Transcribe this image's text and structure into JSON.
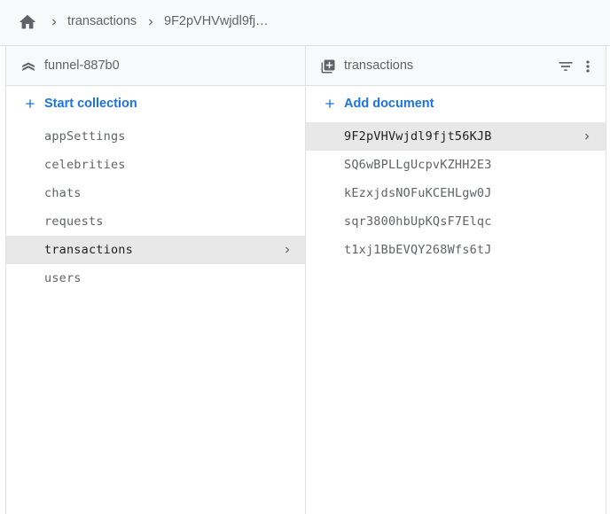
{
  "breadcrumb": {
    "home_icon": "home-icon",
    "items": [
      "transactions",
      "9F2pVHVwjdl9fj…"
    ]
  },
  "left_panel": {
    "project_name": "funnel-887b0",
    "project_icon": "firestore-icon",
    "start_collection_label": "Start collection",
    "collections": [
      "appSettings",
      "celebrities",
      "chats",
      "requests",
      "transactions",
      "users"
    ],
    "selected_collection": "transactions"
  },
  "right_panel": {
    "title": "transactions",
    "title_icon": "collection-icon",
    "add_document_label": "Add document",
    "documents": [
      "9F2pVHVwjdl9fjt56KJB",
      "SQ6wBPLLgUcpvKZHH2E3",
      "kEzxjdsNOFuKCEHLgw0J",
      "sqr3800hbUpKQsF7Elqc",
      "t1xj1BbEVQY268Wfs6tJ"
    ],
    "selected_document": "9F2pVHVwjdl9fjt56KJB"
  },
  "colors": {
    "accent": "#1a73e8",
    "header_bg": "#f8f9fa",
    "selected_bg": "#e8e8e8",
    "text_muted": "#5f6368",
    "icon": "#5f6368"
  }
}
